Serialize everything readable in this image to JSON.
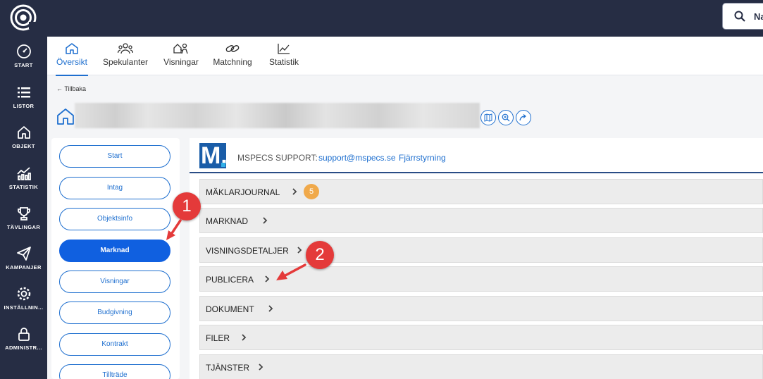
{
  "topbar": {
    "search_text": "Na"
  },
  "sidebar": {
    "items": [
      {
        "label": "START",
        "icon": "gauge-icon"
      },
      {
        "label": "LISTOR",
        "icon": "list-icon"
      },
      {
        "label": "OBJEKT",
        "icon": "home-icon"
      },
      {
        "label": "STATISTIK",
        "icon": "chart-icon"
      },
      {
        "label": "TÄVLINGAR",
        "icon": "trophy-icon"
      },
      {
        "label": "KAMPANJER",
        "icon": "paper-plane-icon"
      },
      {
        "label": "INSTÄLLNIN...",
        "icon": "gear-icon"
      },
      {
        "label": "ADMINISTR...",
        "icon": "lock-icon"
      }
    ]
  },
  "tabs": [
    {
      "label": "Översikt",
      "icon": "home-icon",
      "active": true
    },
    {
      "label": "Spekulanter",
      "icon": "people-icon"
    },
    {
      "label": "Visningar",
      "icon": "viewing-icon"
    },
    {
      "label": "Matchning",
      "icon": "link-icon"
    },
    {
      "label": "Statistik",
      "icon": "line-chart-icon"
    }
  ],
  "back_label": "← Tillbaka",
  "left_menu": [
    "Start",
    "Intag",
    "Objektsinfo",
    "Marknad",
    "Visningar",
    "Budgivning",
    "Kontrakt",
    "Tillträde"
  ],
  "left_menu_active": "Marknad",
  "support": {
    "logo": "M.",
    "label": "MSPECS SUPPORT:",
    "email": "support@mspecs.se",
    "remote": "Fjärrstyrning"
  },
  "sections": [
    {
      "label": "MÄKLARJOURNAL",
      "badge": "5"
    },
    {
      "label": "MARKNAD"
    },
    {
      "label": "VISNINGSDETALJER"
    },
    {
      "label": "PUBLICERA"
    },
    {
      "label": "DOKUMENT"
    },
    {
      "label": "FILER"
    },
    {
      "label": "TJÄNSTER"
    }
  ],
  "annotations": [
    "1",
    "2"
  ],
  "colors": {
    "sidebar": "#262d44",
    "accent": "#1e6fcf",
    "active_pill": "#1060e0",
    "badge": "#f0a94a",
    "annotation": "#e43a3a"
  }
}
